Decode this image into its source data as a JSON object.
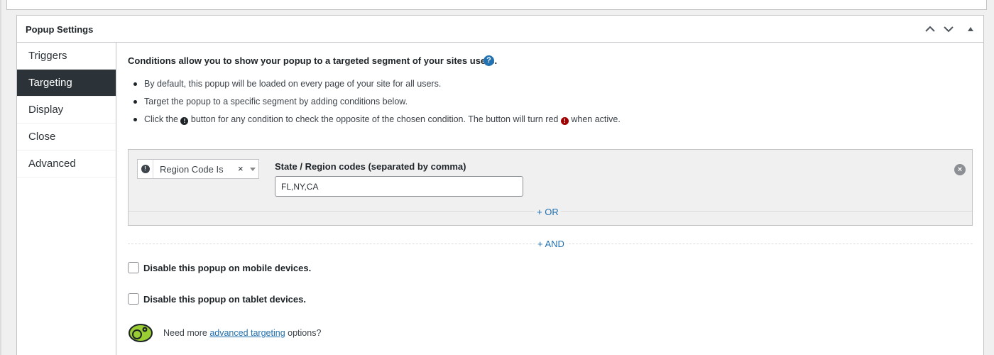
{
  "panel": {
    "title": "Popup Settings"
  },
  "sidebar": {
    "items": [
      {
        "label": "Triggers",
        "active": false
      },
      {
        "label": "Targeting",
        "active": true
      },
      {
        "label": "Display",
        "active": false
      },
      {
        "label": "Close",
        "active": false
      },
      {
        "label": "Advanced",
        "active": false
      }
    ]
  },
  "targeting": {
    "intro": "Conditions allow you to show your popup to a targeted segment of your sites users.",
    "help_icon": "question-circle-icon",
    "bullets": {
      "b1": "By default, this popup will be loaded on every page of your site for all users.",
      "b2": "Target the popup to a specific segment by adding conditions below.",
      "b3_before": "Click the",
      "b3_middle": "button for any condition to check the opposite of the chosen condition. The button will turn red",
      "b3_after": "when active."
    },
    "condition": {
      "selected": "Region Code Is",
      "clear_glyph": "×",
      "field_label": "State / Region codes (separated by comma)",
      "field_value": "FL,NY,CA",
      "or_label": "+ OR"
    },
    "and_label": "+ AND",
    "disable_mobile": "Disable this popup on mobile devices.",
    "disable_tablet": "Disable this popup on tablet devices.",
    "upsell": {
      "before": "Need more",
      "link": "advanced targeting",
      "after": "options?"
    }
  },
  "colors": {
    "accent": "#2271b1",
    "active_tab_bg": "#2c3338",
    "not_active_red": "#a00000",
    "logo_green": "#9acd32"
  }
}
